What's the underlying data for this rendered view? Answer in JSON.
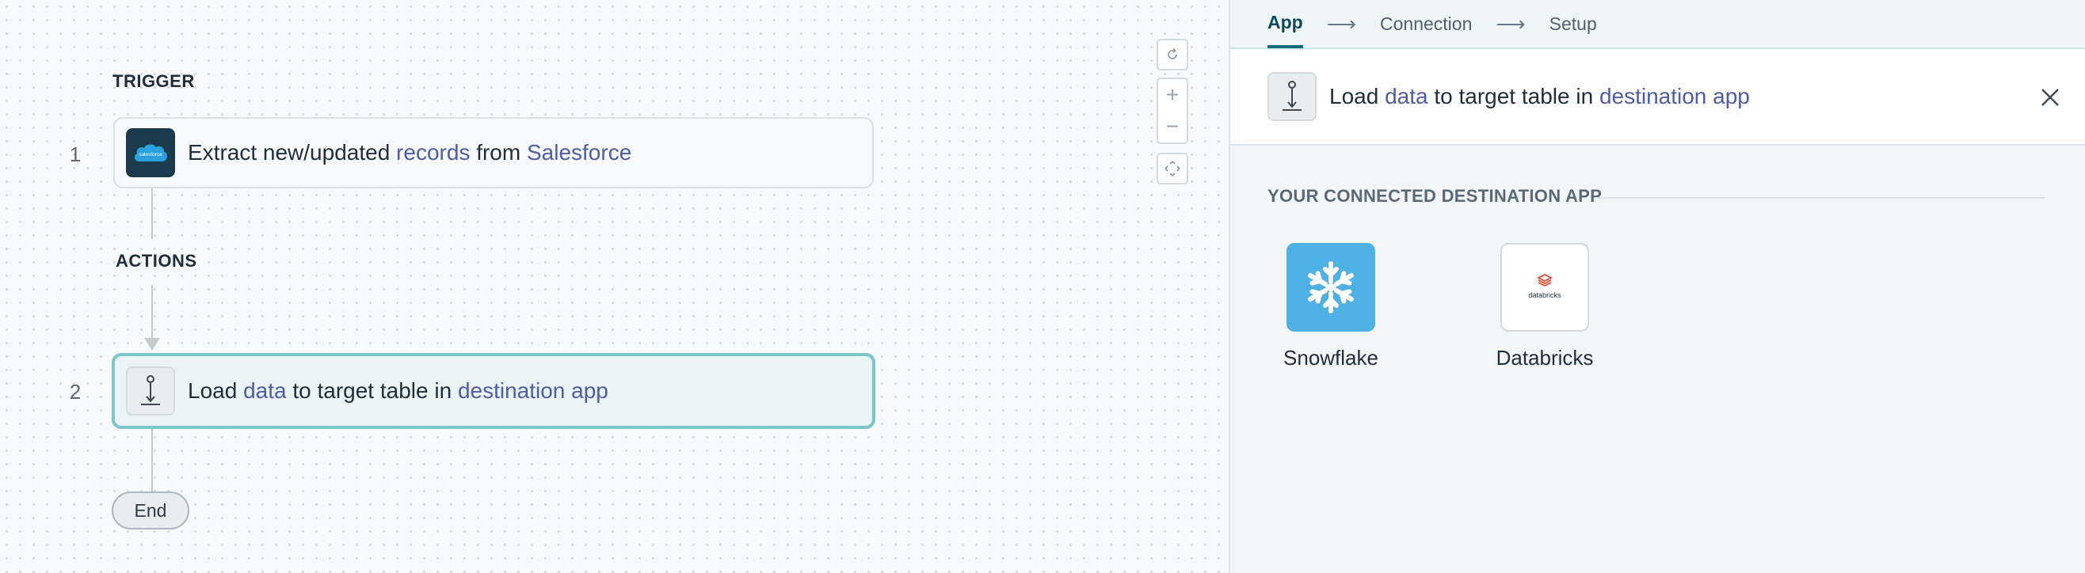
{
  "canvas": {
    "trigger_label": "TRIGGER",
    "actions_label": "ACTIONS",
    "steps": [
      {
        "number": "1",
        "pre": "Extract new/updated ",
        "pill1": "records",
        "mid": " from ",
        "pill2": "Salesforce",
        "post": "",
        "icon": "salesforce-icon"
      },
      {
        "number": "2",
        "pre": "Load ",
        "pill1": "data",
        "mid": " to target table in ",
        "pill2": "destination app",
        "post": "",
        "icon": "load-data-icon"
      }
    ],
    "end_label": "End",
    "controls": [
      "reset-icon",
      "zoom-in-icon",
      "zoom-out-icon",
      "fit-view-icon"
    ]
  },
  "panel": {
    "tabs": [
      {
        "label": "App",
        "active": true
      },
      {
        "label": "Connection",
        "active": false
      },
      {
        "label": "Setup",
        "active": false
      }
    ],
    "header": {
      "pre": "Load ",
      "pill1": "data",
      "mid": " to target table in ",
      "pill2": "destination app"
    },
    "section_heading": "YOUR CONNECTED DESTINATION APP",
    "apps": [
      {
        "name": "Snowflake",
        "color": "#4fb0e3"
      },
      {
        "name": "Databricks",
        "logo_text": "databricks",
        "color": "#e8472f"
      }
    ]
  },
  "colors": {
    "accent": "#1c6a78",
    "pill_text": "#4e5ba6",
    "selected_border": "#7cc7c9"
  }
}
